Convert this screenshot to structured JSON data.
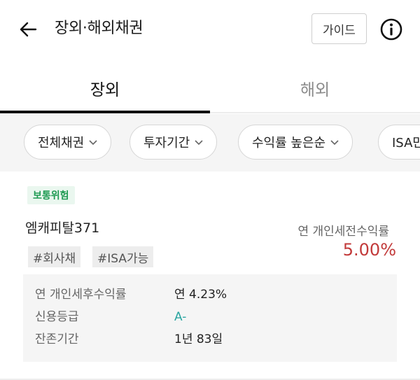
{
  "header": {
    "title": "장외·해외채권",
    "guide_label": "가이드",
    "back_icon": "arrow-left-icon",
    "info_icon": "info-circle-icon"
  },
  "tabs": [
    {
      "label": "장외",
      "active": true
    },
    {
      "label": "해외",
      "active": false
    }
  ],
  "filters": [
    {
      "label": "전체채권"
    },
    {
      "label": "투자기간"
    },
    {
      "label": "수익률 높은순"
    },
    {
      "label": "ISA만"
    }
  ],
  "bond": {
    "risk_badge": "보통위험",
    "name": "엠캐피탈371",
    "tags": [
      "#회사채",
      "#ISA가능"
    ],
    "rate_label": "연 개인세전수익률",
    "rate_value": "5.00%",
    "details": [
      {
        "label": "연 개인세후수익률",
        "value": "연 4.23%"
      },
      {
        "label": "신용등급",
        "value": "A-"
      },
      {
        "label": "잔존기간",
        "value": "1년 83일"
      }
    ]
  },
  "colors": {
    "accent_red": "#c23a3a",
    "risk_green": "#1f9b53",
    "grade_teal": "#2aa5a0"
  }
}
